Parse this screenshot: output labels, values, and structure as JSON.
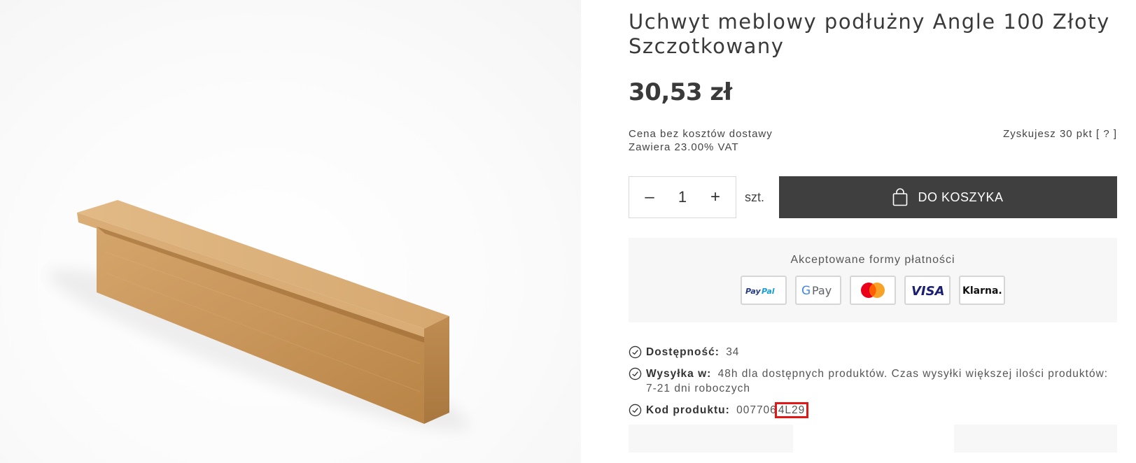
{
  "product": {
    "title": "Uchwyt meblowy podłużny Angle 100 Złoty Szczotkowany",
    "price": "30,53 zł",
    "shipping_note": "Cena bez kosztów dostawy",
    "vat_note": "Zawiera 23.00% VAT",
    "points": "Zyskujesz 30 pkt [ ? ]"
  },
  "buy": {
    "minus": "–",
    "quantity": "1",
    "plus": "+",
    "unit": "szt.",
    "cart_label": "DO KOSZYKA"
  },
  "payments": {
    "title": "Akceptowane formy płatności",
    "methods": [
      "PayPal",
      "G Pay",
      "Mastercard",
      "VISA",
      "Klarna."
    ]
  },
  "details": {
    "availability_label": "Dostępność:",
    "availability_value": "34",
    "shipping_label": "Wysyłka w:",
    "shipping_value": "48h dla dostępnych produktów. Czas wysyłki większej ilości produktów: 7-21 dni roboczych",
    "code_label": "Kod produktu:",
    "code_prefix": "007706",
    "code_highlight": "4L29"
  },
  "colors": {
    "accent_dark": "#3f3f3f",
    "highlight_border": "#e01818",
    "product_gold": "#c9985f"
  }
}
